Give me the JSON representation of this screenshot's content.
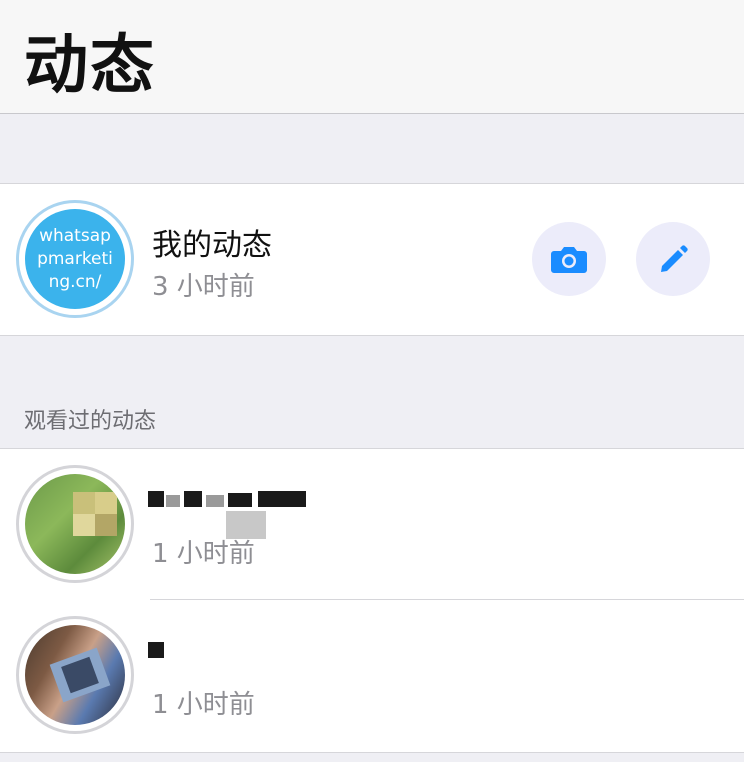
{
  "header": {
    "title": "动态"
  },
  "my_status": {
    "avatar_text": [
      "whatsap",
      "pmarketi",
      "ng.cn/"
    ],
    "name": "我的动态",
    "time": "3 小时前"
  },
  "section": {
    "label": "观看过的动态"
  },
  "viewed": [
    {
      "time": "1 小时前",
      "name_redacted": true
    },
    {
      "time": "1 小时前",
      "name_redacted": true
    }
  ],
  "icons": {
    "camera": "camera-icon",
    "edit": "pencil-icon"
  },
  "colors": {
    "accent": "#1a8cff",
    "button_bg": "#ececfa",
    "avatar_blue": "#3bb3ec"
  }
}
